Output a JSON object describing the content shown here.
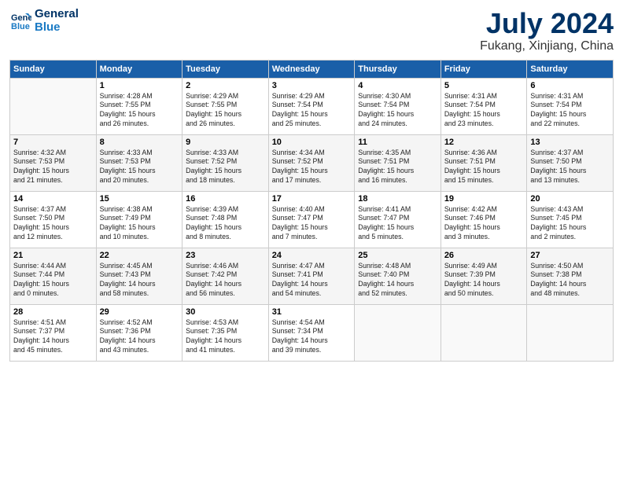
{
  "header": {
    "logo_line1": "General",
    "logo_line2": "Blue",
    "title": "July 2024",
    "subtitle": "Fukang, Xinjiang, China"
  },
  "columns": [
    "Sunday",
    "Monday",
    "Tuesday",
    "Wednesday",
    "Thursday",
    "Friday",
    "Saturday"
  ],
  "rows": [
    [
      {
        "day": "",
        "text": ""
      },
      {
        "day": "1",
        "text": "Sunrise: 4:28 AM\nSunset: 7:55 PM\nDaylight: 15 hours\nand 26 minutes."
      },
      {
        "day": "2",
        "text": "Sunrise: 4:29 AM\nSunset: 7:55 PM\nDaylight: 15 hours\nand 26 minutes."
      },
      {
        "day": "3",
        "text": "Sunrise: 4:29 AM\nSunset: 7:54 PM\nDaylight: 15 hours\nand 25 minutes."
      },
      {
        "day": "4",
        "text": "Sunrise: 4:30 AM\nSunset: 7:54 PM\nDaylight: 15 hours\nand 24 minutes."
      },
      {
        "day": "5",
        "text": "Sunrise: 4:31 AM\nSunset: 7:54 PM\nDaylight: 15 hours\nand 23 minutes."
      },
      {
        "day": "6",
        "text": "Sunrise: 4:31 AM\nSunset: 7:54 PM\nDaylight: 15 hours\nand 22 minutes."
      }
    ],
    [
      {
        "day": "7",
        "text": "Sunrise: 4:32 AM\nSunset: 7:53 PM\nDaylight: 15 hours\nand 21 minutes."
      },
      {
        "day": "8",
        "text": "Sunrise: 4:33 AM\nSunset: 7:53 PM\nDaylight: 15 hours\nand 20 minutes."
      },
      {
        "day": "9",
        "text": "Sunrise: 4:33 AM\nSunset: 7:52 PM\nDaylight: 15 hours\nand 18 minutes."
      },
      {
        "day": "10",
        "text": "Sunrise: 4:34 AM\nSunset: 7:52 PM\nDaylight: 15 hours\nand 17 minutes."
      },
      {
        "day": "11",
        "text": "Sunrise: 4:35 AM\nSunset: 7:51 PM\nDaylight: 15 hours\nand 16 minutes."
      },
      {
        "day": "12",
        "text": "Sunrise: 4:36 AM\nSunset: 7:51 PM\nDaylight: 15 hours\nand 15 minutes."
      },
      {
        "day": "13",
        "text": "Sunrise: 4:37 AM\nSunset: 7:50 PM\nDaylight: 15 hours\nand 13 minutes."
      }
    ],
    [
      {
        "day": "14",
        "text": "Sunrise: 4:37 AM\nSunset: 7:50 PM\nDaylight: 15 hours\nand 12 minutes."
      },
      {
        "day": "15",
        "text": "Sunrise: 4:38 AM\nSunset: 7:49 PM\nDaylight: 15 hours\nand 10 minutes."
      },
      {
        "day": "16",
        "text": "Sunrise: 4:39 AM\nSunset: 7:48 PM\nDaylight: 15 hours\nand 8 minutes."
      },
      {
        "day": "17",
        "text": "Sunrise: 4:40 AM\nSunset: 7:47 PM\nDaylight: 15 hours\nand 7 minutes."
      },
      {
        "day": "18",
        "text": "Sunrise: 4:41 AM\nSunset: 7:47 PM\nDaylight: 15 hours\nand 5 minutes."
      },
      {
        "day": "19",
        "text": "Sunrise: 4:42 AM\nSunset: 7:46 PM\nDaylight: 15 hours\nand 3 minutes."
      },
      {
        "day": "20",
        "text": "Sunrise: 4:43 AM\nSunset: 7:45 PM\nDaylight: 15 hours\nand 2 minutes."
      }
    ],
    [
      {
        "day": "21",
        "text": "Sunrise: 4:44 AM\nSunset: 7:44 PM\nDaylight: 15 hours\nand 0 minutes."
      },
      {
        "day": "22",
        "text": "Sunrise: 4:45 AM\nSunset: 7:43 PM\nDaylight: 14 hours\nand 58 minutes."
      },
      {
        "day": "23",
        "text": "Sunrise: 4:46 AM\nSunset: 7:42 PM\nDaylight: 14 hours\nand 56 minutes."
      },
      {
        "day": "24",
        "text": "Sunrise: 4:47 AM\nSunset: 7:41 PM\nDaylight: 14 hours\nand 54 minutes."
      },
      {
        "day": "25",
        "text": "Sunrise: 4:48 AM\nSunset: 7:40 PM\nDaylight: 14 hours\nand 52 minutes."
      },
      {
        "day": "26",
        "text": "Sunrise: 4:49 AM\nSunset: 7:39 PM\nDaylight: 14 hours\nand 50 minutes."
      },
      {
        "day": "27",
        "text": "Sunrise: 4:50 AM\nSunset: 7:38 PM\nDaylight: 14 hours\nand 48 minutes."
      }
    ],
    [
      {
        "day": "28",
        "text": "Sunrise: 4:51 AM\nSunset: 7:37 PM\nDaylight: 14 hours\nand 45 minutes."
      },
      {
        "day": "29",
        "text": "Sunrise: 4:52 AM\nSunset: 7:36 PM\nDaylight: 14 hours\nand 43 minutes."
      },
      {
        "day": "30",
        "text": "Sunrise: 4:53 AM\nSunset: 7:35 PM\nDaylight: 14 hours\nand 41 minutes."
      },
      {
        "day": "31",
        "text": "Sunrise: 4:54 AM\nSunset: 7:34 PM\nDaylight: 14 hours\nand 39 minutes."
      },
      {
        "day": "",
        "text": ""
      },
      {
        "day": "",
        "text": ""
      },
      {
        "day": "",
        "text": ""
      }
    ]
  ]
}
